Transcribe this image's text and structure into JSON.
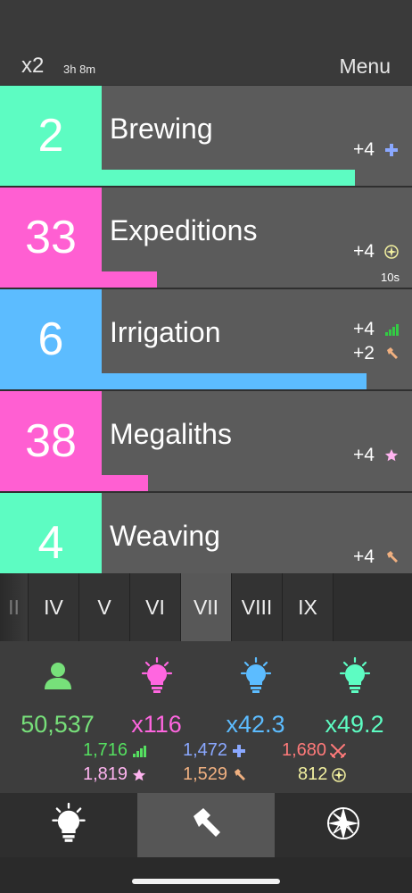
{
  "header": {
    "multiplier": "x2",
    "timer": "3h 8m",
    "menu_label": "Menu"
  },
  "rows": [
    {
      "level": "2",
      "name": "Brewing",
      "color": "#5dfcc2",
      "progress": 0.82,
      "rates": [
        {
          "value": "+4",
          "icon": "medical-cross-icon",
          "color": "#8aa8ff"
        }
      ],
      "countdown": ""
    },
    {
      "level": "33",
      "name": "Expeditions",
      "color": "#ff5fd2",
      "progress": 0.18,
      "rates": [
        {
          "value": "+4",
          "icon": "compass-icon",
          "color": "#f2f0a0"
        }
      ],
      "countdown": "10s"
    },
    {
      "level": "6",
      "name": "Irrigation",
      "color": "#5cbcff",
      "progress": 0.85,
      "rates": [
        {
          "value": "+4",
          "icon": "signal-bars-icon",
          "color": "#33cc44"
        },
        {
          "value": "+2",
          "icon": "hammer-icon",
          "color": "#f0b080"
        }
      ],
      "countdown": ""
    },
    {
      "level": "38",
      "name": "Megaliths",
      "color": "#ff5fd2",
      "progress": 0.15,
      "rates": [
        {
          "value": "+4",
          "icon": "star-icon",
          "color": "#ffb4f0"
        }
      ],
      "countdown": ""
    },
    {
      "level": "4",
      "name": "Weaving",
      "color": "#5dfcc2",
      "progress": 0.0,
      "rates": [
        {
          "value": "+4",
          "icon": "hammer-icon",
          "color": "#f0b080"
        }
      ],
      "countdown": ""
    }
  ],
  "era_tabs": [
    "II",
    "IV",
    "V",
    "VI",
    "VII",
    "VIII",
    "IX"
  ],
  "active_era": "VII",
  "stats": [
    {
      "value": "50,537",
      "icon": "population-icon",
      "color": "#77e07a"
    },
    {
      "value": "x116",
      "icon": "pink-lightbulb-icon",
      "color": "#ff66e0"
    },
    {
      "value": "x42.3",
      "icon": "blue-lightbulb-icon",
      "color": "#5cbcff"
    },
    {
      "value": "x49.2",
      "icon": "green-lightbulb-icon",
      "color": "#5dfcc2"
    }
  ],
  "resources": [
    {
      "value": "1,716",
      "icon": "signal-bars-icon",
      "color": "#55e060"
    },
    {
      "value": "1,472",
      "icon": "medical-cross-icon",
      "color": "#8aa8ff"
    },
    {
      "value": "1,680",
      "icon": "crossed-swords-icon",
      "color": "#ff7a7a"
    },
    {
      "value": "1,819",
      "icon": "star-icon",
      "color": "#ffb4f0"
    },
    {
      "value": "1,529",
      "icon": "hammer-icon",
      "color": "#f0b080"
    },
    {
      "value": "812",
      "icon": "compass-icon",
      "color": "#f2f0a0"
    }
  ],
  "bottom_nav": [
    {
      "icon": "lightbulb-icon"
    },
    {
      "icon": "hammer-icon"
    },
    {
      "icon": "compass-rose-icon"
    }
  ]
}
